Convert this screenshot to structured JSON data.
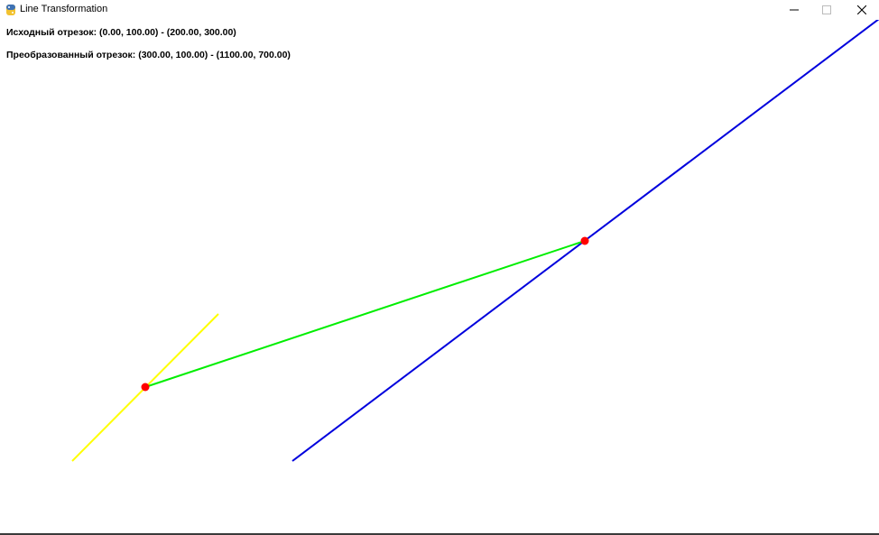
{
  "window": {
    "title": "Line Transformation",
    "icon": "snake-icon",
    "controls": [
      "minimize-icon",
      "maximize-icon",
      "close-icon"
    ]
  },
  "info": {
    "original_segment": "Исходный отрезок: (0.00, 100.00) - (200.00, 300.00)",
    "transformed_segment": "Преобразованный отрезок: (300.00, 100.00) - (1100.00, 700.00)"
  },
  "scene": {
    "colors": {
      "original_line": "#ffff00",
      "transformed_line": "#0000dd",
      "connector_line": "#00ee00",
      "point": "#ff0000"
    }
  }
}
